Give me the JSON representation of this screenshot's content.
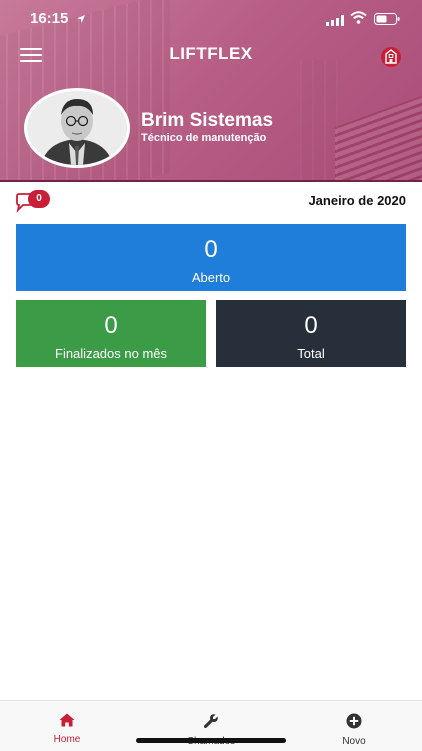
{
  "status_bar": {
    "time": "16:15"
  },
  "header": {
    "app_title": "LIFTFLEX",
    "user_name": "Brim Sistemas",
    "user_role": "Técnico de manutenção"
  },
  "summary": {
    "notification_count": "0",
    "month_label": "Janeiro de 2020"
  },
  "cards": {
    "aberto": {
      "value": "0",
      "label": "Aberto"
    },
    "finalizados": {
      "value": "0",
      "label": "Finalizados no mês"
    },
    "total": {
      "value": "0",
      "label": "Total"
    }
  },
  "tabs": {
    "home": "Home",
    "chamados": "Chamados",
    "novo": "Novo"
  },
  "colors": {
    "header_accent": "#b85f86",
    "active_tab": "#c81e37",
    "card_aberto": "#1f7ed9",
    "card_finalizados": "#3c9b46",
    "card_total": "#27303a"
  },
  "icons": {
    "status_location": "location-arrow-icon",
    "status_signal": "signal-icon",
    "status_wifi": "wifi-icon",
    "status_battery": "battery-icon",
    "menu": "hamburger-menu-icon",
    "header_action": "building-icon",
    "chat": "chat-bubble-icon",
    "tab_home": "home-icon",
    "tab_chamados": "wrench-icon",
    "tab_novo": "plus-circle-icon"
  }
}
